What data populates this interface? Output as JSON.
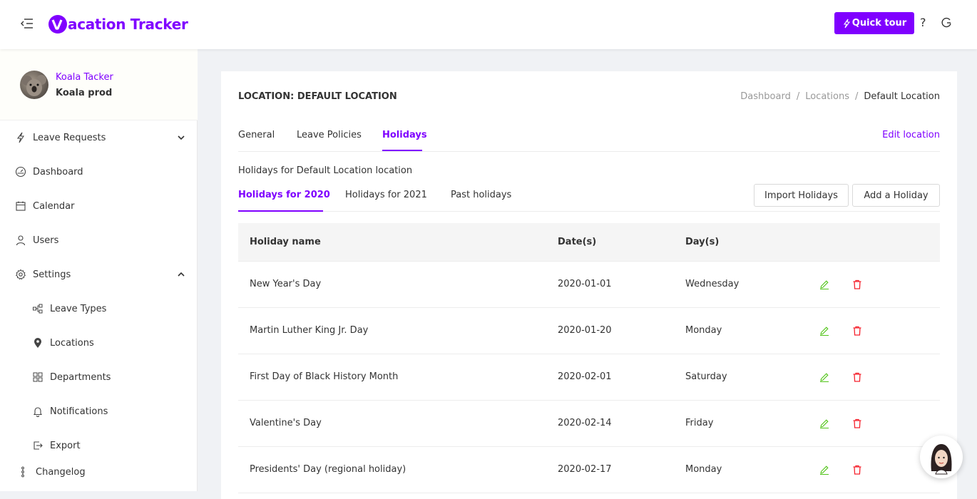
{
  "header": {
    "logo_text": "acation Tracker",
    "quick_tour_label": "Quick tour",
    "help_label": "?"
  },
  "profile": {
    "name": "Koala Tacker",
    "company": "Koala prod"
  },
  "sidebar": {
    "items": [
      {
        "label": "Leave Requests",
        "icon": "lightning-icon"
      },
      {
        "label": "Dashboard",
        "icon": "dashboard-icon"
      },
      {
        "label": "Calendar",
        "icon": "calendar-icon"
      },
      {
        "label": "Users",
        "icon": "user-icon"
      },
      {
        "label": "Settings",
        "icon": "gear-icon"
      },
      {
        "label": "Leave Types",
        "icon": "leave-types-icon"
      },
      {
        "label": "Locations",
        "icon": "location-pin-icon"
      },
      {
        "label": "Departments",
        "icon": "departments-icon"
      },
      {
        "label": "Notifications",
        "icon": "bell-icon"
      },
      {
        "label": "Export",
        "icon": "export-icon"
      },
      {
        "label": "Changelog",
        "icon": "changelog-icon"
      }
    ]
  },
  "page": {
    "title": "LOCATION: DEFAULT LOCATION",
    "breadcrumb": [
      "Dashboard",
      "Locations",
      "Default Location"
    ],
    "tabs": [
      "General",
      "Leave Policies",
      "Holidays"
    ],
    "active_tab": "Holidays",
    "edit_location_label": "Edit location",
    "caption": "Holidays for Default Location location",
    "subtabs": [
      "Holidays for 2020",
      "Holidays for 2021",
      "Past holidays"
    ],
    "active_subtab": "Holidays for 2020",
    "import_label": "Import Holidays",
    "add_label": "Add a Holiday"
  },
  "table": {
    "columns": [
      "Holiday name",
      "Date(s)",
      "Day(s)"
    ],
    "rows": [
      {
        "name": "New Year's Day",
        "date": "2020-01-01",
        "day": "Wednesday"
      },
      {
        "name": "Martin Luther King Jr. Day",
        "date": "2020-01-20",
        "day": "Monday"
      },
      {
        "name": "First Day of Black History Month",
        "date": "2020-02-01",
        "day": "Saturday"
      },
      {
        "name": "Valentine's Day",
        "date": "2020-02-14",
        "day": "Friday"
      },
      {
        "name": "Presidents' Day (regional holiday)",
        "date": "2020-02-17",
        "day": "Monday"
      }
    ]
  },
  "colors": {
    "accent": "#7f00ff",
    "edit_icon": "#52c41a",
    "delete_icon": "#f5222d"
  }
}
